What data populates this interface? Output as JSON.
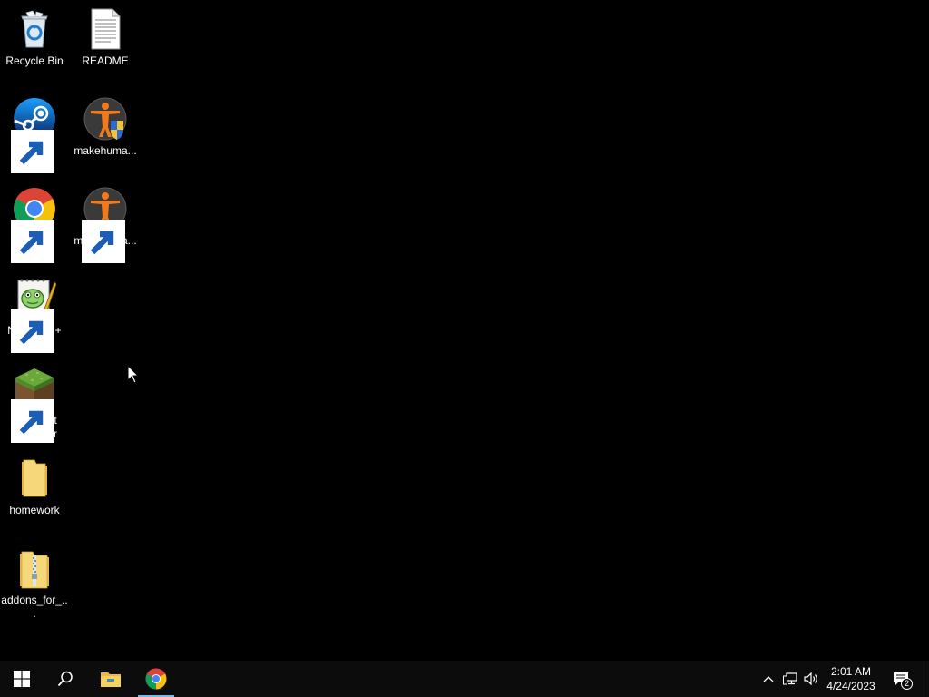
{
  "desktop": {
    "icons": [
      {
        "label": "Recycle Bin",
        "icon": "recycle-bin-icon"
      },
      {
        "label": "README",
        "icon": "text-document-icon"
      },
      {
        "label": "Steam",
        "icon": "steam-icon"
      },
      {
        "label": "makehuma...",
        "icon": "makehuman-admin-icon"
      },
      {
        "label": "Google Chrome",
        "icon": "chrome-icon"
      },
      {
        "label": "makehuma...",
        "icon": "makehuman-icon"
      },
      {
        "label": "Notepad++",
        "icon": "notepad-plus-plus-icon"
      },
      {
        "label": "Minecraft Launcher",
        "icon": "minecraft-grass-block-icon"
      },
      {
        "label": "homework",
        "icon": "folder-icon"
      },
      {
        "label": "addons_for_...",
        "icon": "zip-folder-icon"
      }
    ]
  },
  "taskbar": {
    "start": "windows-start-icon",
    "search": "search-icon",
    "pinned": [
      {
        "name": "File Explorer",
        "icon": "file-explorer-icon"
      },
      {
        "name": "Google Chrome",
        "icon": "chrome-icon",
        "active": true
      }
    ],
    "tray": {
      "icons": [
        "chevron-up-icon",
        "network-icon",
        "volume-icon"
      ],
      "time": "2:01 AM",
      "date": "4/24/2023",
      "notification_count": "2"
    }
  },
  "colors": {
    "desktop_bg": "#000000",
    "taskbar_bg": "#0c0c0c",
    "active_indicator": "#76b9ed"
  }
}
